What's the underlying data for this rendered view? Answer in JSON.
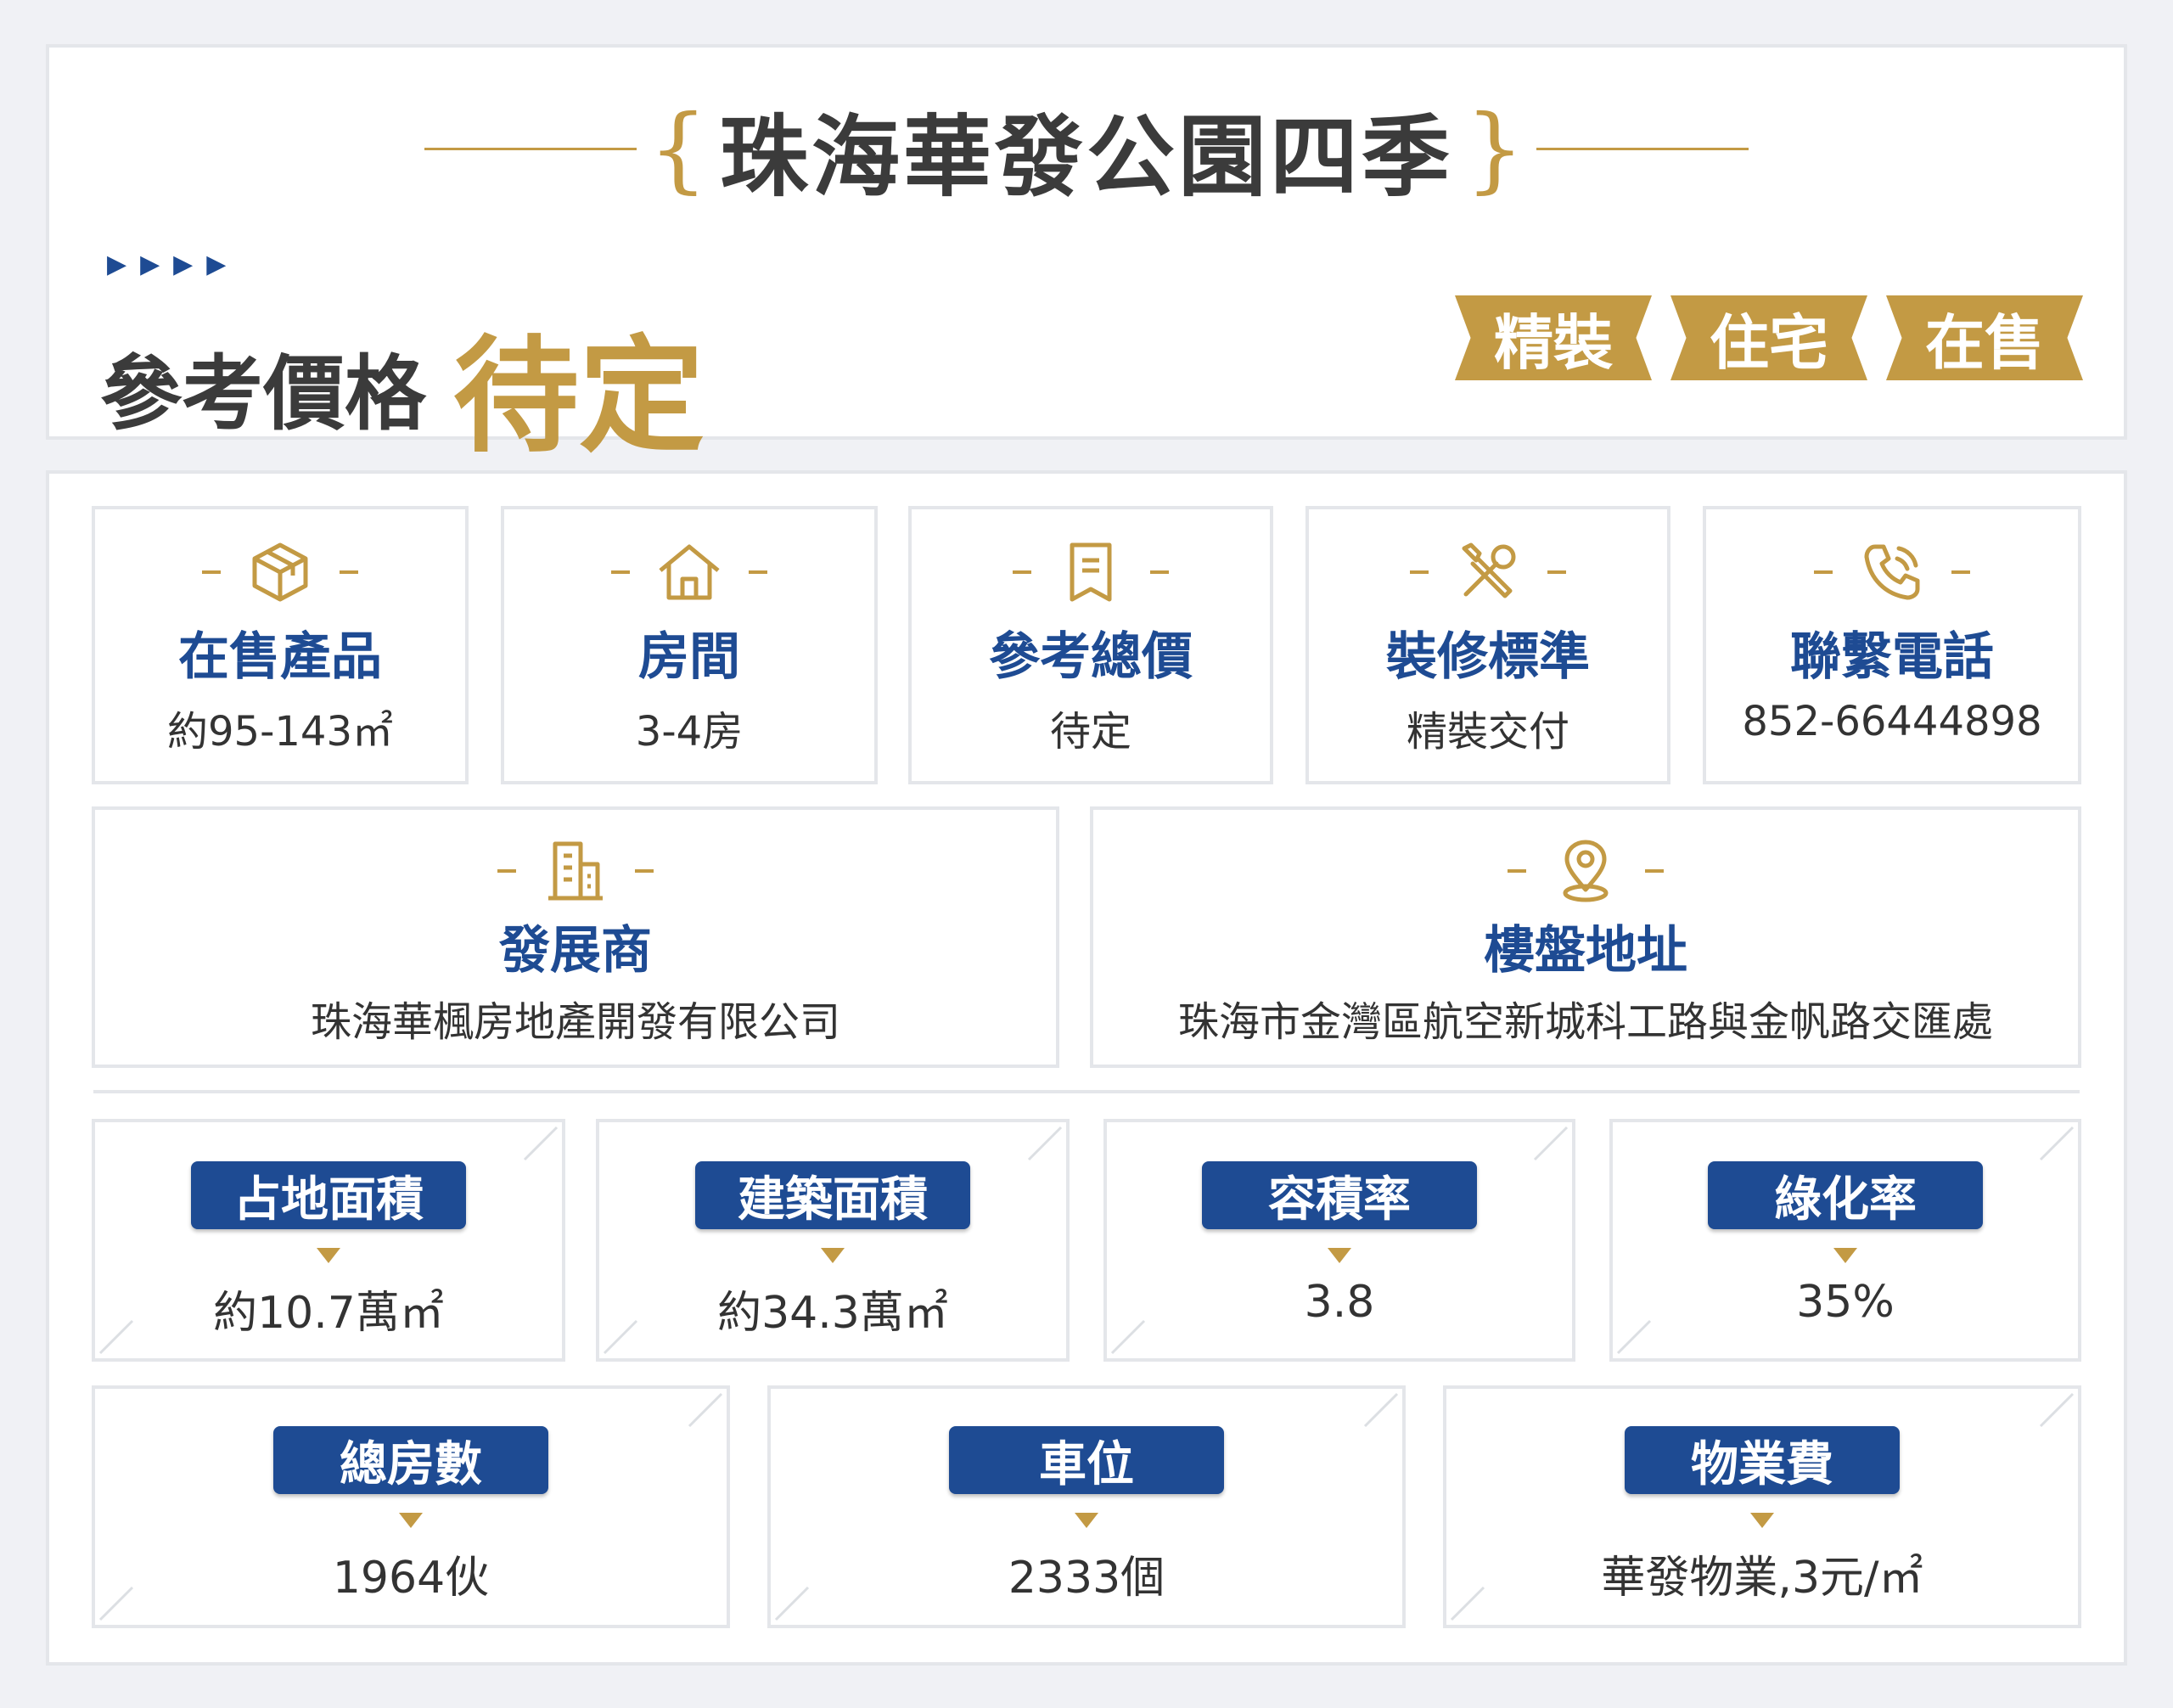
{
  "header": {
    "title": "珠海華發公園四季",
    "price_label": "參考價格",
    "price_value": "待定",
    "tags": [
      "精裝",
      "住宅",
      "在售"
    ]
  },
  "info": [
    {
      "label": "在售產品",
      "value": "約95-143㎡",
      "icon": "box-icon"
    },
    {
      "label": "房間",
      "value": "3-4房",
      "icon": "house-icon"
    },
    {
      "label": "參考總價",
      "value": "待定",
      "icon": "receipt-icon"
    },
    {
      "label": "裝修標準",
      "value": "精裝交付",
      "icon": "tools-icon"
    },
    {
      "label": "聯繫電話",
      "value": "852-66444898",
      "icon": "phone-icon"
    }
  ],
  "developer": {
    "label": "發展商",
    "value": "珠海華楓房地產開發有限公司",
    "icon": "building-icon"
  },
  "address": {
    "label": "樓盤地址",
    "value": "珠海市金灣區航空新城科工路與金帆路交匯處",
    "icon": "location-pin-icon"
  },
  "stats_row1": [
    {
      "label": "占地面積",
      "value": "約10.7萬㎡"
    },
    {
      "label": "建築面積",
      "value": "約34.3萬㎡"
    },
    {
      "label": "容積率",
      "value": "3.8"
    },
    {
      "label": "綠化率",
      "value": "35%"
    }
  ],
  "stats_row2": [
    {
      "label": "總房數",
      "value": "1964伙"
    },
    {
      "label": "車位",
      "value": "2333個"
    },
    {
      "label": "物業費",
      "value": "華發物業,3元/㎡"
    }
  ],
  "colors": {
    "gold": "#c39a44",
    "blue": "#1e4b93",
    "text": "#3b3b3b"
  }
}
